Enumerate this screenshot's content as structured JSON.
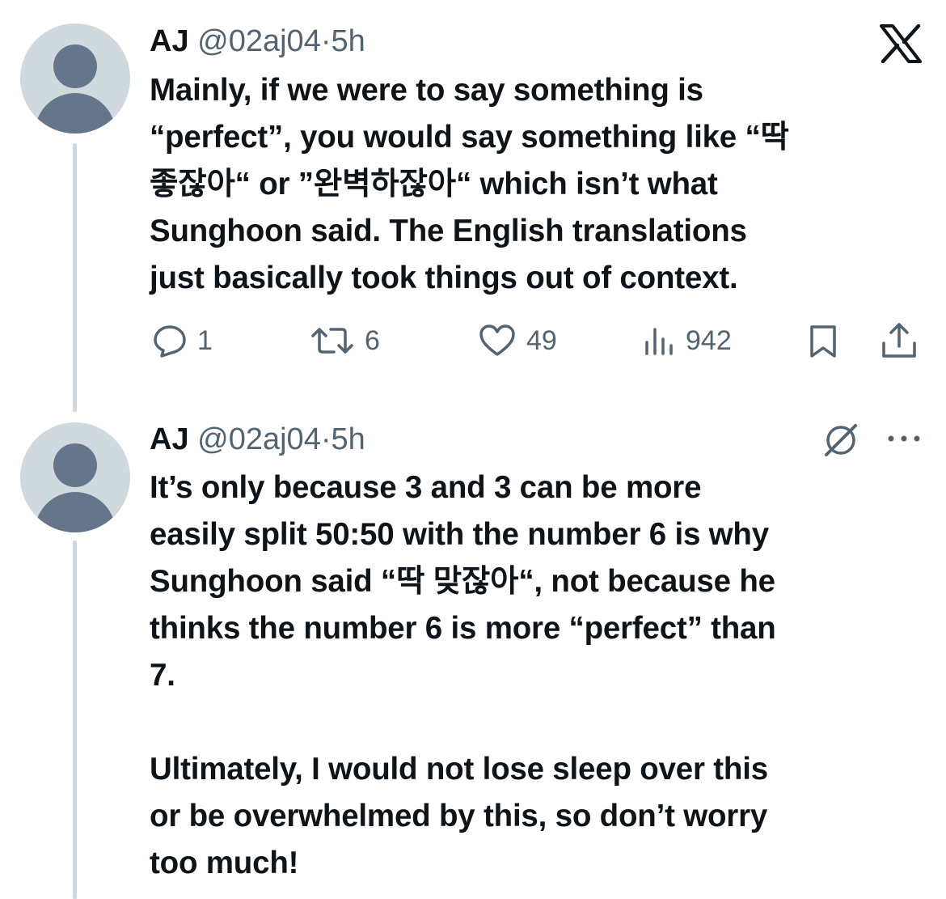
{
  "tweets": [
    {
      "author": {
        "name": "AJ",
        "handle": "@02aj04",
        "separator": "·",
        "time": "5h"
      },
      "lines": [
        "Mainly, if we were to say something is",
        "“perfect”, you would say something like “딱",
        "좋잖아“ or ”완벽하잖아“ which isn’t what",
        "Sunghoon said. The English translations",
        "just basically took things out of context."
      ],
      "metrics": {
        "replies": "1",
        "reposts": "6",
        "likes": "49",
        "views": "942"
      }
    },
    {
      "author": {
        "name": "AJ",
        "handle": "@02aj04",
        "separator": "·",
        "time": "5h"
      },
      "lines": [
        "It’s only because 3 and 3 can be more",
        "easily split 50:50 with the number 6 is why",
        "Sunghoon said “딱 맞잖아“, not because he",
        "thinks the number 6 is more “perfect” than",
        "7.",
        "",
        "Ultimately, I would not lose sleep over this",
        "or be overwhelmed by this, so don’t worry",
        "too much!"
      ]
    }
  ],
  "icons": {
    "close": "x-logo-icon",
    "reply": "reply-icon",
    "repost": "repost-icon",
    "like": "heart-icon",
    "views": "views-icon",
    "bookmark": "bookmark-icon",
    "share": "share-icon",
    "grok": "grok-icon",
    "more": "more-icon"
  },
  "colors": {
    "text": "#0f1419",
    "secondary": "#536471",
    "avatar_bg": "#cfd9de",
    "avatar_fg": "#66768a"
  }
}
